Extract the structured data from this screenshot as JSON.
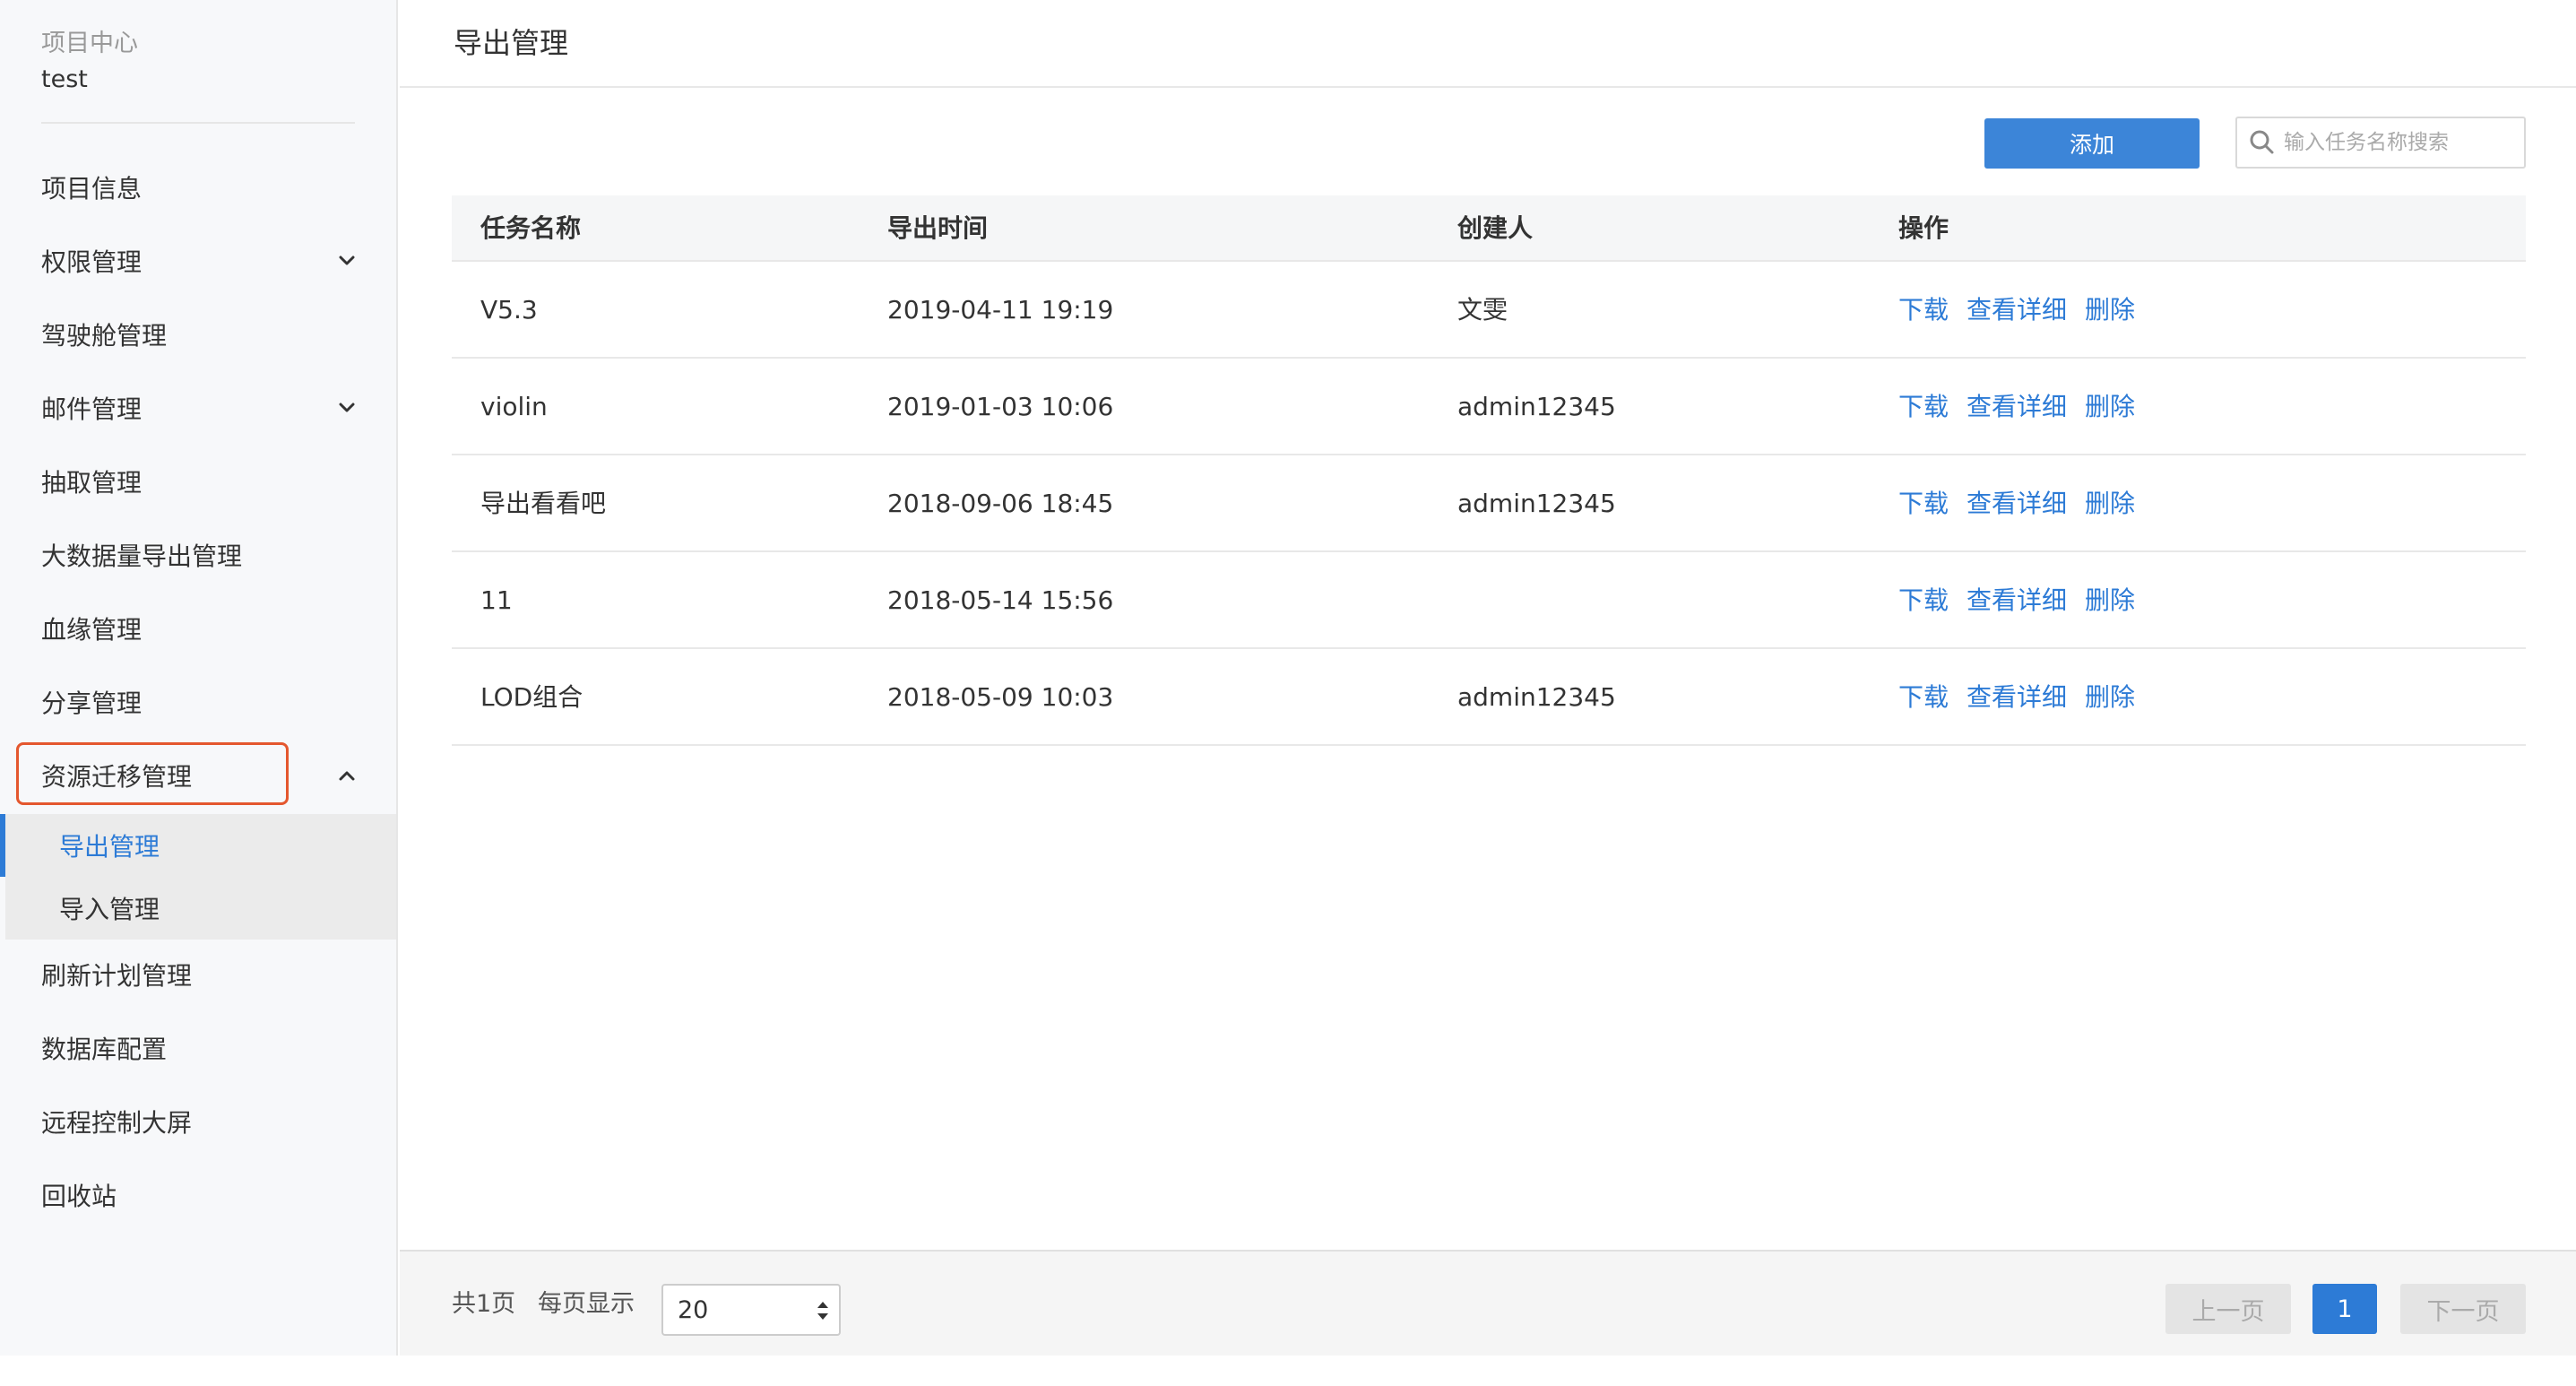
{
  "sidebar": {
    "project_label": "项目中心",
    "project_name": "test",
    "items": [
      {
        "label": "项目信息"
      },
      {
        "label": "权限管理",
        "chevron": "chevron-down-icon"
      },
      {
        "label": "驾驶舱管理"
      },
      {
        "label": "邮件管理",
        "chevron": "chevron-down-icon"
      },
      {
        "label": "抽取管理"
      },
      {
        "label": "大数据量导出管理"
      },
      {
        "label": "血缘管理"
      },
      {
        "label": "分享管理"
      },
      {
        "label": "资源迁移管理",
        "chevron": "chevron-up-icon",
        "expanded": true
      },
      {
        "label": "刷新计划管理"
      },
      {
        "label": "数据库配置"
      },
      {
        "label": "远程控制大屏"
      },
      {
        "label": "回收站"
      }
    ],
    "sub_items": [
      {
        "label": "导出管理",
        "active": true
      },
      {
        "label": "导入管理"
      }
    ],
    "highlight_color": "#e4572e"
  },
  "header": {
    "title": "导出管理"
  },
  "toolbar": {
    "add_label": "添加",
    "search_placeholder": "输入任务名称搜索"
  },
  "table": {
    "columns": [
      "任务名称",
      "导出时间",
      "创建人",
      "操作"
    ],
    "rows": [
      {
        "name": "V5.3",
        "time": "2019-04-11 19:19",
        "creator": "文雯"
      },
      {
        "name": "violin",
        "time": "2019-01-03 10:06",
        "creator": "admin12345"
      },
      {
        "name": "导出看看吧",
        "time": "2018-09-06 18:45",
        "creator": "admin12345"
      },
      {
        "name": "11",
        "time": "2018-05-14 15:56",
        "creator": ""
      },
      {
        "name": "LOD组合",
        "time": "2018-05-09 10:03",
        "creator": "admin12345"
      }
    ],
    "ops": {
      "download": "下载",
      "detail": "查看详细",
      "delete": "删除"
    }
  },
  "footer": {
    "total": "共1页",
    "per_page_label": "每页显示",
    "per_page_value": "20",
    "prev": "上一页",
    "page": "1",
    "next": "下一页"
  },
  "colors": {
    "accent": "#2d7bd6",
    "button": "#3c85d8"
  }
}
